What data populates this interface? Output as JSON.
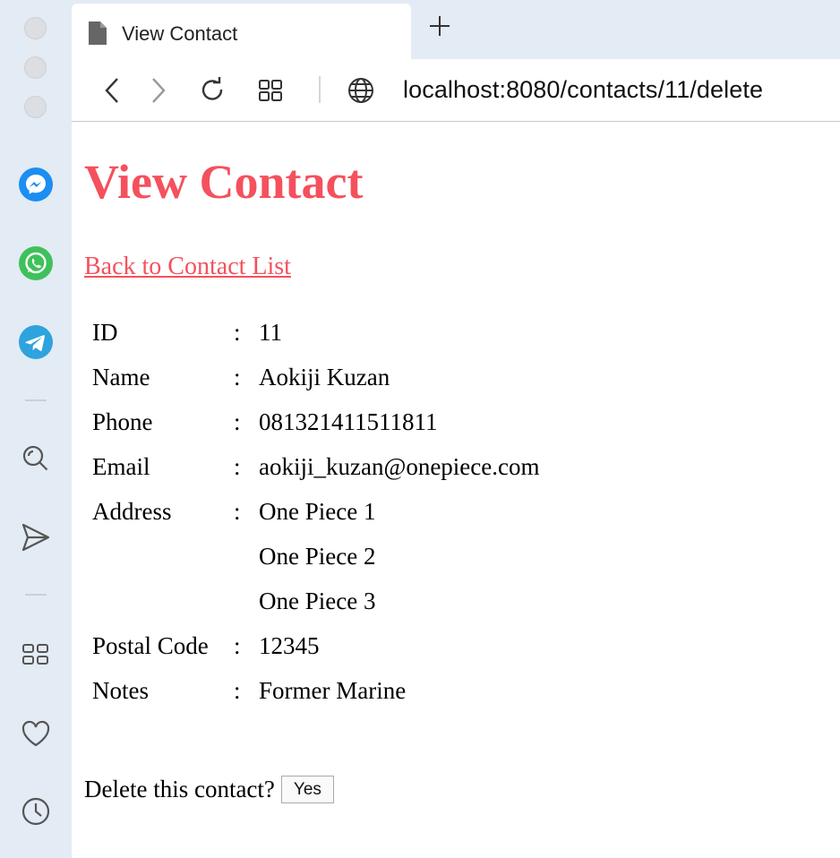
{
  "browser": {
    "tab": {
      "title": "View Contact",
      "icon": "document-icon"
    },
    "new_tab_icon": "plus-icon",
    "toolbar": {
      "back_icon": "chevron-left-icon",
      "forward_icon": "chevron-right-icon",
      "reload_icon": "reload-icon",
      "tabs_icon": "grid-icon",
      "site_icon": "globe-icon",
      "url": "localhost:8080/contacts/11/delete"
    },
    "sidebar": {
      "items": [
        "messenger-icon",
        "whatsapp-icon",
        "telegram-icon",
        "search-icon",
        "send-icon",
        "panels-icon",
        "heart-icon",
        "clock-icon"
      ]
    }
  },
  "page": {
    "title": "View Contact",
    "back_link": "Back to Contact List",
    "fields": [
      {
        "label": "ID",
        "colon": ":",
        "value": "11"
      },
      {
        "label": "Name",
        "colon": ":",
        "value": "Aokiji Kuzan"
      },
      {
        "label": "Phone",
        "colon": ":",
        "value": "081321411511811"
      },
      {
        "label": "Email",
        "colon": ":",
        "value": "aokiji_kuzan@onepiece.com"
      },
      {
        "label": "Address",
        "colon": ":",
        "value": "One Piece 1"
      },
      {
        "label": "",
        "colon": "",
        "value": "One Piece 2"
      },
      {
        "label": "",
        "colon": "",
        "value": "One Piece 3"
      },
      {
        "label": "Postal Code",
        "colon": ":",
        "value": "12345"
      },
      {
        "label": "Notes",
        "colon": ":",
        "value": "Former Marine"
      }
    ],
    "delete_prompt": "Delete this contact?",
    "yes_button": "Yes"
  },
  "colors": {
    "accent": "#f4515d",
    "sidebar_bg": "#e3ebf4",
    "messenger": "#1b8ef2",
    "whatsapp": "#3ec15a",
    "telegram": "#2ea3dd"
  }
}
